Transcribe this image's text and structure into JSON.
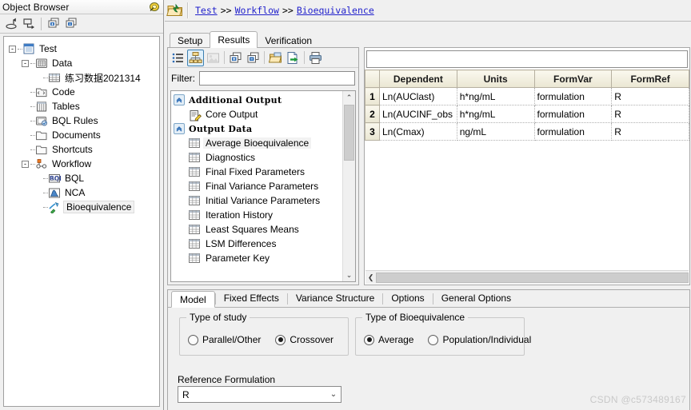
{
  "object_browser": {
    "title": "Object Browser",
    "pin_icon": "pushpin-icon",
    "toolbar": [
      {
        "name": "navigate-back-icon",
        "label": "Back"
      },
      {
        "name": "navigate-forward-icon",
        "label": "Forward"
      },
      {
        "name": "expand-all-icon",
        "label": "Expand All"
      },
      {
        "name": "collapse-all-icon",
        "label": "Collapse All"
      }
    ],
    "tree": [
      {
        "label": "Test",
        "icon": "project-icon",
        "depth": 0,
        "expander": "-",
        "selected": false
      },
      {
        "label": "Data",
        "icon": "data-folder-icon",
        "depth": 1,
        "expander": "-",
        "selected": false
      },
      {
        "label": "练习数据2021314",
        "icon": "table-icon",
        "depth": 2,
        "expander": "",
        "selected": false
      },
      {
        "label": "Code",
        "icon": "code-folder-icon",
        "depth": 1,
        "expander": "",
        "selected": false
      },
      {
        "label": "Tables",
        "icon": "tables-icon",
        "depth": 1,
        "expander": "",
        "selected": false
      },
      {
        "label": "BQL Rules",
        "icon": "bql-rules-icon",
        "depth": 1,
        "expander": "",
        "selected": false
      },
      {
        "label": "Documents",
        "icon": "folder-icon",
        "depth": 1,
        "expander": "",
        "selected": false
      },
      {
        "label": "Shortcuts",
        "icon": "folder-icon",
        "depth": 1,
        "expander": "",
        "selected": false
      },
      {
        "label": "Workflow",
        "icon": "workflow-icon",
        "depth": 1,
        "expander": "-",
        "selected": false
      },
      {
        "label": "BQL",
        "icon": "bql-icon",
        "depth": 2,
        "expander": "",
        "selected": false
      },
      {
        "label": "NCA",
        "icon": "nca-icon",
        "depth": 2,
        "expander": "",
        "selected": false
      },
      {
        "label": "Bioequivalence",
        "icon": "bioequivalence-icon",
        "depth": 2,
        "expander": "",
        "selected": true
      }
    ]
  },
  "breadcrumb": {
    "app_icon": "folder-arrow-icon",
    "separator": ">>",
    "items": [
      "Test",
      "Workflow",
      "Bioequivalence"
    ]
  },
  "top_tabs": [
    {
      "label": "Setup",
      "active": false
    },
    {
      "label": "Results",
      "active": true
    },
    {
      "label": "Verification",
      "active": false
    }
  ],
  "results_toolbar": [
    {
      "name": "list-view-icon",
      "state": "normal"
    },
    {
      "name": "tree-view-icon",
      "state": "selected"
    },
    {
      "name": "image-view-icon",
      "state": "disabled"
    },
    {
      "name": "expand-all-icon",
      "state": "normal"
    },
    {
      "name": "collapse-all-icon",
      "state": "normal"
    },
    {
      "name": "open-folder-icon",
      "state": "normal"
    },
    {
      "name": "export-icon",
      "state": "normal"
    },
    {
      "name": "print-icon",
      "state": "normal"
    }
  ],
  "filter": {
    "label": "Filter:",
    "value": "",
    "placeholder": ""
  },
  "output_tree": {
    "groups": [
      {
        "name": "Additional Output",
        "collapse_icon": "chevron-up-icon",
        "items": [
          {
            "label": "Core Output",
            "icon": "document-edit-icon",
            "selected": false
          }
        ]
      },
      {
        "name": "Output Data",
        "collapse_icon": "chevron-up-icon",
        "items": [
          {
            "label": "Average Bioequivalence",
            "icon": "grid-icon",
            "selected": true
          },
          {
            "label": "Diagnostics",
            "icon": "grid-icon",
            "selected": false
          },
          {
            "label": "Final Fixed Parameters",
            "icon": "grid-icon",
            "selected": false
          },
          {
            "label": "Final Variance Parameters",
            "icon": "grid-icon",
            "selected": false
          },
          {
            "label": "Initial Variance Parameters",
            "icon": "grid-icon",
            "selected": false
          },
          {
            "label": "Iteration History",
            "icon": "grid-icon",
            "selected": false
          },
          {
            "label": "Least Squares Means",
            "icon": "grid-icon",
            "selected": false
          },
          {
            "label": "LSM Differences",
            "icon": "grid-icon",
            "selected": false
          },
          {
            "label": "Parameter Key",
            "icon": "grid-icon",
            "selected": false
          }
        ]
      }
    ],
    "scrollbar": {
      "up_arrow": "⌃",
      "down_arrow": "⌄"
    }
  },
  "grid": {
    "formula_value": "",
    "columns": [
      "Dependent",
      "Units",
      "FormVar",
      "FormRef"
    ],
    "rows": [
      {
        "num": "1",
        "cells": [
          "Ln(AUClast)",
          "h*ng/mL",
          "formulation",
          "R"
        ]
      },
      {
        "num": "2",
        "cells": [
          "Ln(AUCINF_obs",
          "h*ng/mL",
          "formulation",
          "R"
        ]
      },
      {
        "num": "3",
        "cells": [
          "Ln(Cmax)",
          "ng/mL",
          "formulation",
          "R"
        ]
      }
    ],
    "hscroll_left_arrow": "❮"
  },
  "bottom_tabs": [
    {
      "label": "Model",
      "active": true
    },
    {
      "label": "Fixed Effects",
      "active": false
    },
    {
      "label": "Variance Structure",
      "active": false
    },
    {
      "label": "Options",
      "active": false
    },
    {
      "label": "General Options",
      "active": false
    }
  ],
  "model_panel": {
    "type_of_study": {
      "legend": "Type of study",
      "options": [
        {
          "label": "Parallel/Other",
          "selected": false
        },
        {
          "label": "Crossover",
          "selected": true
        }
      ]
    },
    "type_of_bioequivalence": {
      "legend": "Type of Bioequivalence",
      "options": [
        {
          "label": "Average",
          "selected": true
        },
        {
          "label": "Population/Individual",
          "selected": false
        }
      ]
    },
    "reference_formulation": {
      "label": "Reference Formulation",
      "value": "R",
      "chevron": "⌄"
    }
  },
  "watermark": "CSDN @c573489167"
}
